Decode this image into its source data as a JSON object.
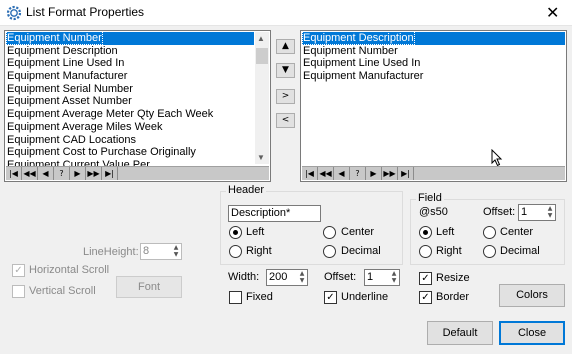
{
  "window": {
    "title": "List Format Properties"
  },
  "left_list": {
    "items": [
      "Equipment Number",
      "Equipment Description",
      "Equipment Line Used In",
      "Equipment Manufacturer",
      "Equipment Serial Number",
      "Equipment Asset Number",
      "Equipment Average Meter Qty Each Week",
      "Equipment Average Miles Week",
      "Equipment CAD Locations",
      "Equipment Cost to Purchase Originally",
      "Equipment Current Value Per..."
    ],
    "selected_index": 0
  },
  "right_list": {
    "items": [
      "Equipment Description",
      "Equipment Number",
      "Equipment Line Used In",
      "Equipment Manufacturer"
    ],
    "selected_index": 0
  },
  "nav_buttons": [
    "|◀",
    "◀◀",
    "◀",
    "?",
    "▶",
    "▶▶",
    "▶|"
  ],
  "move_buttons": {
    "up": "▲",
    "down": "▼",
    "add": ">",
    "remove": "<"
  },
  "header_group": {
    "label": "Header",
    "text_value": "Description*",
    "align_left": "Left",
    "align_center": "Center",
    "align_right": "Right",
    "align_decimal": "Decimal",
    "selected": "Left"
  },
  "field_group": {
    "label": "Field",
    "format": "@s50",
    "offset_label": "Offset:",
    "offset_value": "1",
    "align_left": "Left",
    "align_center": "Center",
    "align_right": "Right",
    "align_decimal": "Decimal",
    "selected": "Left"
  },
  "width": {
    "label": "Width:",
    "value": "200"
  },
  "offset": {
    "label": "Offset:",
    "value": "1"
  },
  "checks": {
    "fixed": {
      "label": "Fixed",
      "checked": false
    },
    "underline": {
      "label": "Underline",
      "checked": true
    },
    "resize": {
      "label": "Resize",
      "checked": true
    },
    "border": {
      "label": "Border",
      "checked": true
    },
    "horizontal_scroll": {
      "label": "Horizontal Scroll",
      "checked": true,
      "disabled": true
    },
    "vertical_scroll": {
      "label": "Vertical Scroll",
      "checked": false,
      "disabled": true
    }
  },
  "line_height": {
    "label": "LineHeight:",
    "value": "8"
  },
  "buttons": {
    "font": "Font",
    "colors": "Colors",
    "default": "Default",
    "close": "Close"
  },
  "colors": {
    "accent": "#0078d7",
    "selection": "#0078d7"
  }
}
